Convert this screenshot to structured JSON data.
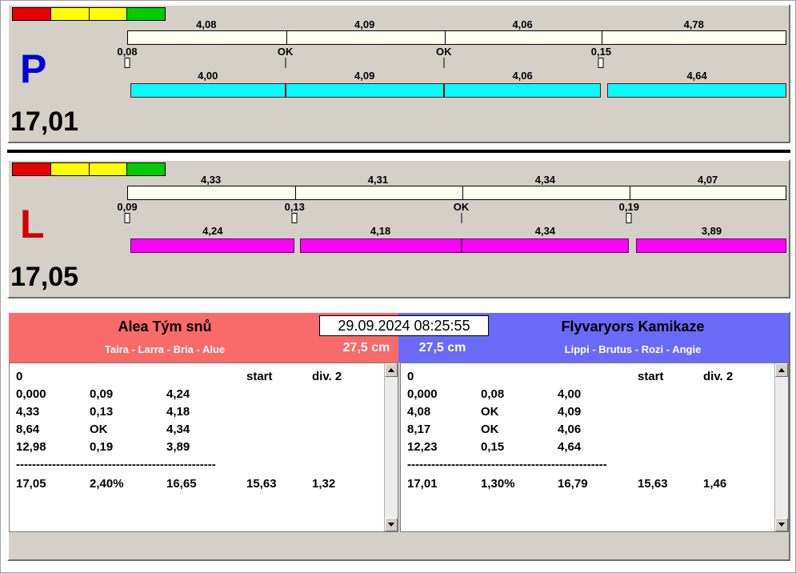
{
  "datetime": "29.09.2024 08:25:55",
  "status_lights": [
    "#e60000",
    "#ffff00",
    "#ffff00",
    "#00cc00"
  ],
  "lanes": [
    {
      "letter": "P",
      "letter_color": "#0000d2",
      "total": "17,01",
      "upper_bar_color": "#fffff0",
      "bar_color": "#00ffff",
      "bar_border": "#8b0000",
      "upper_values": [
        "4,08",
        "4,09",
        "4,06",
        "4,78"
      ],
      "ticks": [
        "0,08",
        "OK",
        "OK",
        "0,15"
      ],
      "lower_values": [
        "4,00",
        "4,09",
        "4,06",
        "4,64"
      ]
    },
    {
      "letter": "L",
      "letter_color": "#d20000",
      "total": "17,05",
      "upper_bar_color": "#fffff0",
      "bar_color": "#ff00ff",
      "bar_border": "#580058",
      "upper_values": [
        "4,33",
        "4,31",
        "4,34",
        "4,07"
      ],
      "ticks": [
        "0,09",
        "0,13",
        "OK",
        "0,19"
      ],
      "lower_values": [
        "4,24",
        "4,18",
        "4,34",
        "3,89"
      ]
    }
  ],
  "teams": [
    {
      "name": "Alea Tým snů",
      "members": "Taira - Larra - Bria - Alue",
      "height": "27,5 cm",
      "header_color": "#f96a6a",
      "table": {
        "head": [
          "0",
          "",
          "",
          "start",
          "div. 2"
        ],
        "rows": [
          [
            "0,000",
            "0,09",
            "4,24",
            "",
            ""
          ],
          [
            "4,33",
            "0,13",
            "4,18",
            "",
            ""
          ],
          [
            "8,64",
            "OK",
            "4,34",
            "",
            ""
          ],
          [
            "12,98",
            "0,19",
            "3,89",
            "",
            ""
          ]
        ],
        "separator": "--------------------------------------------------",
        "total": [
          "17,05",
          "2,40%",
          "16,65",
          "15,63",
          "1,32"
        ]
      }
    },
    {
      "name": "Flyvaryors Kamikaze",
      "members": "Lippi - Brutus - Rozi - Angie",
      "height": "27,5 cm",
      "header_color": "#6a6af9",
      "table": {
        "head": [
          "0",
          "",
          "",
          "start",
          "div. 2"
        ],
        "rows": [
          [
            "0,000",
            "0,08",
            "4,00",
            "",
            ""
          ],
          [
            "4,08",
            "OK",
            "4,09",
            "",
            ""
          ],
          [
            "8,17",
            "OK",
            "4,06",
            "",
            ""
          ],
          [
            "12,23",
            "0,15",
            "4,64",
            "",
            ""
          ]
        ],
        "separator": "--------------------------------------------------",
        "total": [
          "17,01",
          "1,30%",
          "16,79",
          "15,63",
          "1,46"
        ]
      }
    }
  ]
}
